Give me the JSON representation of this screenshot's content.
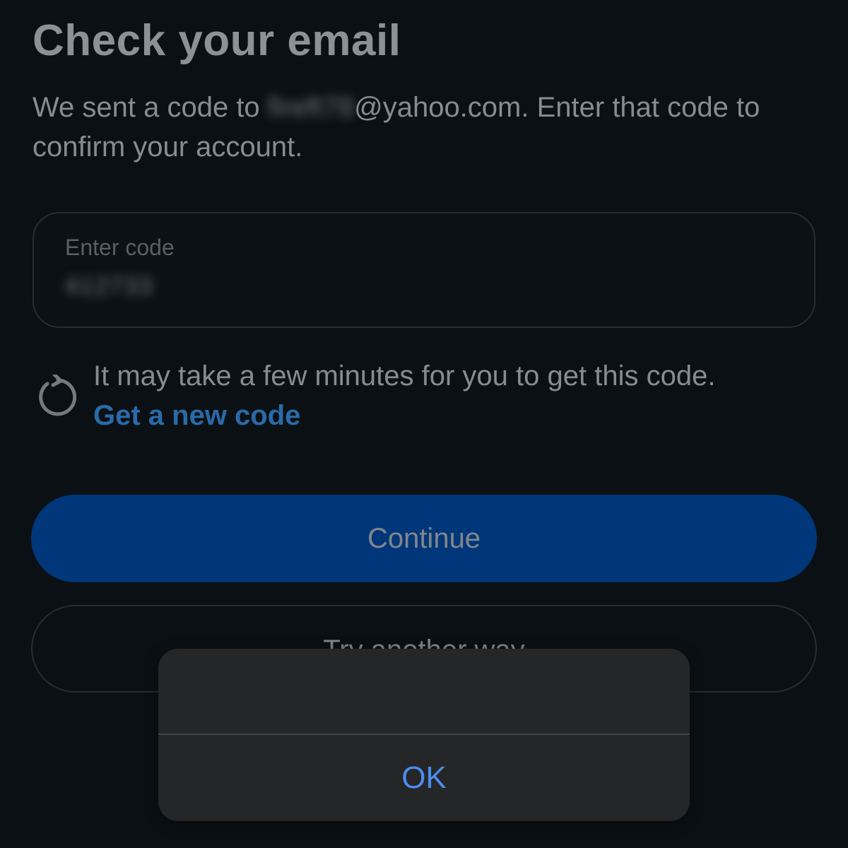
{
  "header": {
    "title": "Check your email"
  },
  "message": {
    "prefix": "We sent a code to ",
    "email_local_redacted": "fireft78",
    "email_domain": "@yahoo.com",
    "suffix": ". Enter that code to confirm your account."
  },
  "code_field": {
    "label": "Enter code",
    "value_redacted": "412733"
  },
  "hint": {
    "text": "It may take a few minutes for you to get this code.",
    "link_label": "Get a new code",
    "icon": "refresh-icon"
  },
  "buttons": {
    "continue_label": "Continue",
    "another_way_label": "Try another way"
  },
  "alert": {
    "ok_label": "OK"
  },
  "colors": {
    "background": "#0b1014",
    "primary_button": "#00367a",
    "link": "#2a6aa8",
    "alert_ok": "#4a8df0"
  }
}
